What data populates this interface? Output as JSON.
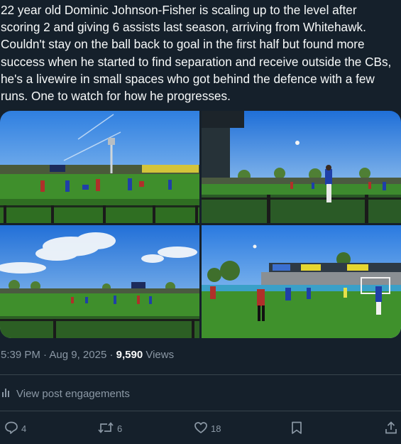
{
  "post": {
    "text_lines": [
      "22 year old Dominic Johnson-Fisher is scaling up to the level after",
      "scoring 2 and giving 6 assists last season, arriving from Whitehawk.",
      "Couldn't stay on the ball back to goal in the first half but found more",
      "success when he started to find separation and receive outside the CBs,",
      "he's a livewire in small spaces who got behind the defence with a few",
      "runs. One to watch for how he progresses."
    ],
    "time": "5:39 PM",
    "separator": "·",
    "date": "Aug 9, 2025",
    "views_count": "9,590",
    "views_label": "Views"
  },
  "engagements_label": "View post engagements",
  "actions": {
    "reply_count": "4",
    "repost_count": "6",
    "like_count": "18"
  },
  "icons": {
    "analytics": "bar-chart-icon",
    "reply": "speech-bubble-icon",
    "repost": "retweet-icon",
    "like": "heart-icon",
    "bookmark": "bookmark-icon",
    "share": "share-upload-icon"
  },
  "colors": {
    "background": "#15202b",
    "text": "#f7f9f9",
    "muted": "#8b98a5",
    "divider": "#38444d"
  }
}
